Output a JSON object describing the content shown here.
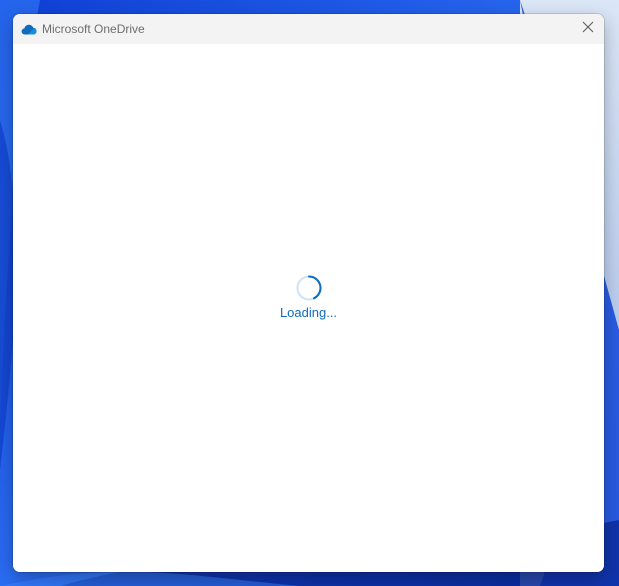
{
  "window": {
    "title": "Microsoft OneDrive",
    "app_icon": "onedrive-cloud-icon",
    "close_icon": "close-icon"
  },
  "content": {
    "status_text": "Loading...",
    "spinner_icon": "spinner-icon"
  },
  "colors": {
    "accent": "#0f6cbd",
    "titlebar": "#f3f3f3",
    "wallpaper": "#1d57e6"
  }
}
